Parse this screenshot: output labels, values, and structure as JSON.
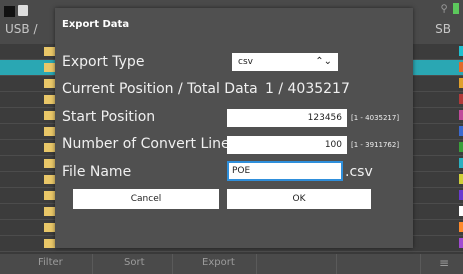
{
  "background": {
    "location_label": "USB /",
    "right_label": "SB",
    "bottom_bar": [
      "Filter",
      "Sort",
      "Export"
    ],
    "menu_icon": "hamburger-icon",
    "strip_colors": [
      "#1ec0d0",
      "#e06a2c",
      "#e0a02c",
      "#b23a3a",
      "#c04a9a",
      "#3c6ad0",
      "#3aa03a",
      "#2cb0c0",
      "#d0d03a",
      "#6a3ad0",
      "#ffffff",
      "#ff8a2c",
      "#a04ad0"
    ]
  },
  "dialog": {
    "title": "Export Data",
    "export_type_label": "Export Type",
    "export_type_value": "csv",
    "current_position_label": "Current Position / Total Data",
    "current_position_value": "1 / 4035217",
    "start_position_label": "Start Position",
    "start_position_value": "123456",
    "start_position_range": "[1 - 4035217]",
    "convert_lines_label": "Number of Convert Lines",
    "convert_lines_value": "100",
    "convert_lines_range": "[1 - 3911762]",
    "file_name_label": "File Name",
    "file_name_value": "POE",
    "file_ext": ".csv",
    "cancel_label": "Cancel",
    "ok_label": "OK"
  }
}
